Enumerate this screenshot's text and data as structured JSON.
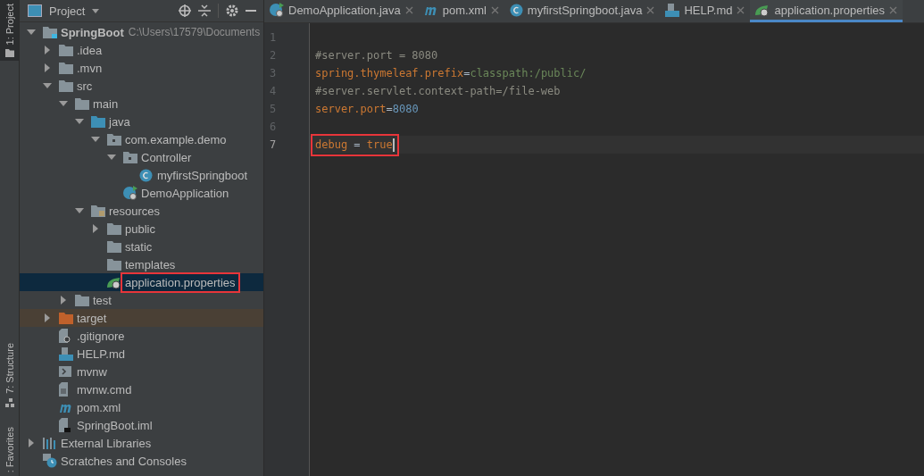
{
  "tool_stripe": [
    {
      "label": "1: Project",
      "kind": "project",
      "selected": true
    },
    {
      "label": "7: Structure",
      "kind": "structure",
      "selected": false
    },
    {
      "label": ": Favorites",
      "kind": "favorites",
      "selected": false
    }
  ],
  "project_panel": {
    "title": "Project",
    "tree": [
      {
        "label": "SpringBoot",
        "kind": "module",
        "path": "C:\\Users\\17579\\Documents",
        "expanded": true,
        "selected": false,
        "children": [
          {
            "label": ".idea",
            "kind": "folder",
            "expanded": false,
            "selected": false
          },
          {
            "label": ".mvn",
            "kind": "folder",
            "expanded": false,
            "selected": false
          },
          {
            "label": "src",
            "kind": "folder",
            "expanded": true,
            "selected": false,
            "children": [
              {
                "label": "main",
                "kind": "folder",
                "expanded": true,
                "selected": false,
                "children": [
                  {
                    "label": "java",
                    "kind": "source",
                    "expanded": true,
                    "selected": false,
                    "children": [
                      {
                        "label": "com.example.demo",
                        "kind": "package",
                        "expanded": true,
                        "selected": false,
                        "children": [
                          {
                            "label": "Controller",
                            "kind": "package",
                            "expanded": true,
                            "selected": false,
                            "children": [
                              {
                                "label": "myfirstSpringboot",
                                "kind": "class",
                                "selected": false
                              }
                            ]
                          },
                          {
                            "label": "DemoApplication",
                            "kind": "spring-class",
                            "selected": false
                          }
                        ]
                      }
                    ]
                  },
                  {
                    "label": "resources",
                    "kind": "resources",
                    "expanded": true,
                    "selected": false,
                    "children": [
                      {
                        "label": "public",
                        "kind": "folder",
                        "expanded": false,
                        "selected": false
                      },
                      {
                        "label": "static",
                        "kind": "folder",
                        "selected": false
                      },
                      {
                        "label": "templates",
                        "kind": "folder",
                        "selected": false
                      },
                      {
                        "label": "application.properties",
                        "kind": "spring-props",
                        "selected": true,
                        "highlighted": true
                      }
                    ]
                  }
                ]
              },
              {
                "label": "test",
                "kind": "folder",
                "expanded": false,
                "selected": false
              }
            ]
          },
          {
            "label": "target",
            "kind": "excluded",
            "expanded": false,
            "selected": false
          },
          {
            "label": ".gitignore",
            "kind": "ignore",
            "selected": false
          },
          {
            "label": "HELP.md",
            "kind": "md",
            "selected": false
          },
          {
            "label": "mvnw",
            "kind": "shell",
            "selected": false
          },
          {
            "label": "mvnw.cmd",
            "kind": "text",
            "selected": false
          },
          {
            "label": "pom.xml",
            "kind": "maven",
            "selected": false
          },
          {
            "label": "SpringBoot.iml",
            "kind": "iml",
            "selected": false
          }
        ]
      },
      {
        "label": "External Libraries",
        "kind": "libraries",
        "expanded": false,
        "selected": false
      },
      {
        "label": "Scratches and Consoles",
        "kind": "scratches",
        "selected": false
      }
    ]
  },
  "tabs": [
    {
      "label": "DemoApplication.java",
      "kind": "spring-class",
      "selected": false
    },
    {
      "label": "pom.xml",
      "kind": "maven",
      "selected": false
    },
    {
      "label": "myfirstSpringboot.java",
      "kind": "class",
      "selected": false
    },
    {
      "label": "HELP.md",
      "kind": "md",
      "selected": false
    },
    {
      "label": "application.properties",
      "kind": "spring-props",
      "selected": true
    }
  ],
  "editor": {
    "lines": [
      {
        "number": "1",
        "current": false
      },
      {
        "number": "2",
        "current": false,
        "tokens": [
          {
            "text": "#server.port = 8080",
            "kind": "comment"
          }
        ]
      },
      {
        "number": "3",
        "current": false,
        "tokens": [
          {
            "text": "spring.thymeleaf.prefix",
            "kind": "key"
          },
          {
            "text": "=",
            "kind": "op"
          },
          {
            "text": "classpath:/public/",
            "kind": "value"
          }
        ]
      },
      {
        "number": "4",
        "current": false,
        "tokens": [
          {
            "text": "#server.servlet.context-path=/file-web",
            "kind": "comment"
          }
        ]
      },
      {
        "number": "5",
        "current": false,
        "tokens": [
          {
            "text": "server.port",
            "kind": "key"
          },
          {
            "text": "=",
            "kind": "op"
          },
          {
            "text": "8080",
            "kind": "number"
          }
        ]
      },
      {
        "number": "6",
        "current": false
      },
      {
        "number": "7",
        "current": true,
        "highlighted": true,
        "tokens": [
          {
            "text": "debug",
            "kind": "key"
          },
          {
            "text": " = ",
            "kind": "op"
          },
          {
            "text": "true",
            "kind": "key"
          }
        ]
      }
    ]
  }
}
